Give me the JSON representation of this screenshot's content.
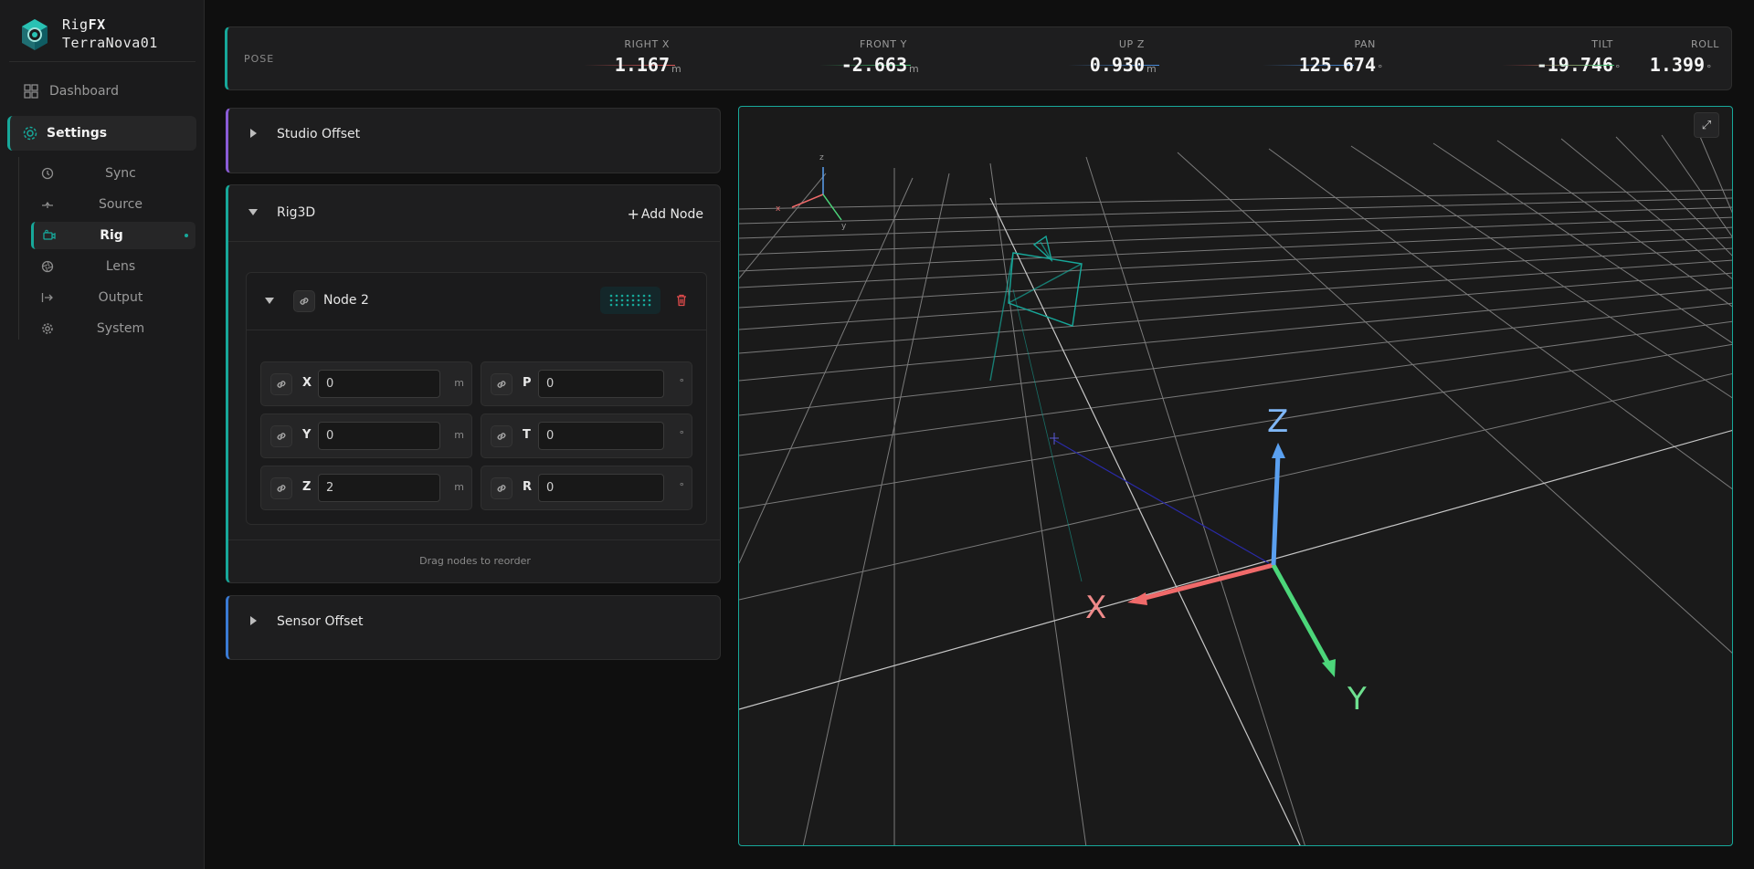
{
  "brand": {
    "name_prefix": "Rig",
    "name_suffix": "FX",
    "instance": "TerraNova01"
  },
  "nav": {
    "dashboard": "Dashboard",
    "settings": "Settings",
    "sub": [
      {
        "label": "Sync",
        "icon": "clock-icon"
      },
      {
        "label": "Source",
        "icon": "source-icon"
      },
      {
        "label": "Rig",
        "icon": "camera-icon"
      },
      {
        "label": "Lens",
        "icon": "aperture-icon"
      },
      {
        "label": "Output",
        "icon": "output-icon"
      },
      {
        "label": "System",
        "icon": "gear-icon"
      }
    ]
  },
  "pose": {
    "title": "POSE",
    "items": [
      {
        "label": "RIGHT X",
        "value": "1.167",
        "unit": "m",
        "color": "#e05a5a"
      },
      {
        "label": "FRONT Y",
        "value": "-2.663",
        "unit": "m",
        "color": "#3ec46d"
      },
      {
        "label": "UP Z",
        "value": "0.930",
        "unit": "m",
        "color": "#4a8fe0"
      },
      {
        "label": "PAN",
        "value": "125.674",
        "unit": "°",
        "color": "#4a8fe0"
      },
      {
        "label": "TILT",
        "value": "-19.746",
        "unit": "°",
        "color": "#e05a5a"
      },
      {
        "label": "ROLL",
        "value": "1.399",
        "unit": "°",
        "color": "#3ec46d"
      }
    ]
  },
  "panels": {
    "studio_offset": {
      "title": "Studio Offset",
      "accent": "#8a5cd6"
    },
    "rig3d": {
      "title": "Rig3D",
      "add_node": "Add Node",
      "accent": "#17a89a",
      "node": {
        "title": "Node 2",
        "fields": [
          {
            "axis": "X",
            "value": "0",
            "unit": "m"
          },
          {
            "axis": "P",
            "value": "0",
            "unit": "°"
          },
          {
            "axis": "Y",
            "value": "0",
            "unit": "m"
          },
          {
            "axis": "T",
            "value": "0",
            "unit": "°"
          },
          {
            "axis": "Z",
            "value": "2",
            "unit": "m"
          },
          {
            "axis": "R",
            "value": "0",
            "unit": "°"
          }
        ]
      },
      "hint": "Drag nodes to reorder"
    },
    "sensor_offset": {
      "title": "Sensor Offset",
      "accent": "#3a7bd5"
    }
  },
  "viewport": {
    "axis_labels": {
      "x": "X",
      "y": "Y",
      "z": "Z"
    },
    "gizmo_labels": {
      "x": "x",
      "y": "y",
      "z": "z"
    },
    "expand_icon": "⤢"
  },
  "colors": {
    "accent": "#17a89a",
    "axis_x": "#f06a6a",
    "axis_y": "#4cd67a",
    "axis_z": "#5aa0f0"
  }
}
